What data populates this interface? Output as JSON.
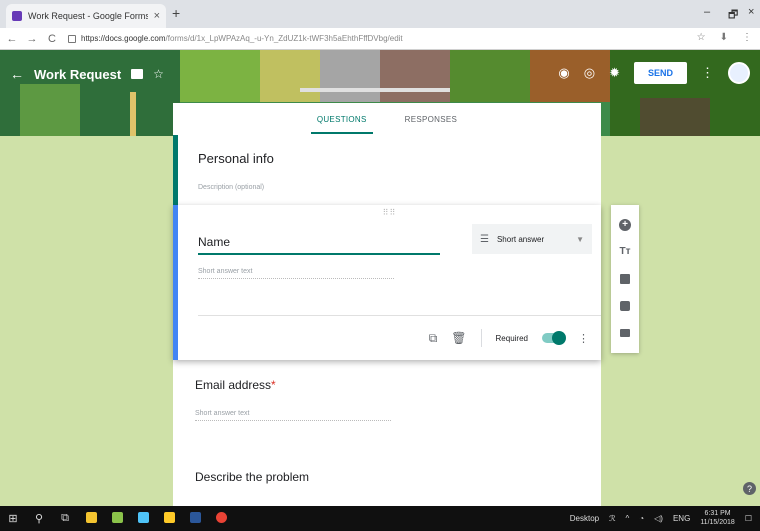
{
  "browser": {
    "tab_title": "Work Request - Google Forms",
    "tab_close": "×",
    "new_tab": "+",
    "url_host": "https://docs.google.com",
    "url_path": "/forms/d/1x_LpWPAzAq_-u-Yn_ZdUZ1k-tWF3h5aEhthFffDVbg/edit",
    "win_min": "–",
    "win_max": "🗗",
    "win_close": "×"
  },
  "header": {
    "title": "Work Request",
    "send_label": "SEND"
  },
  "tabs": [
    {
      "label": "QUESTIONS",
      "active": true
    },
    {
      "label": "RESPONSES",
      "active": false
    }
  ],
  "section": {
    "title": "Personal info",
    "description_placeholder": "Description (optional)"
  },
  "question": {
    "title": "Name",
    "type": "Short answer",
    "answer_placeholder": "Short answer text",
    "required_label": "Required",
    "required": true
  },
  "email_question": {
    "title": "Email address",
    "required_marker": "*",
    "answer_placeholder": "Short answer text"
  },
  "problem_question": {
    "title": "Describe the problem"
  },
  "sidebar_tools": [
    "add-question",
    "add-title",
    "add-image",
    "add-video",
    "add-section"
  ],
  "help": "?",
  "taskbar": {
    "desktop_label": "Desktop",
    "lang": "ENG",
    "time": "6:31 PM",
    "date": "11/15/2018"
  },
  "colors": {
    "accent": "#00796b",
    "background": "#cfe1a8",
    "banner": "#3d8a4a",
    "active_card": "#4285f4"
  }
}
